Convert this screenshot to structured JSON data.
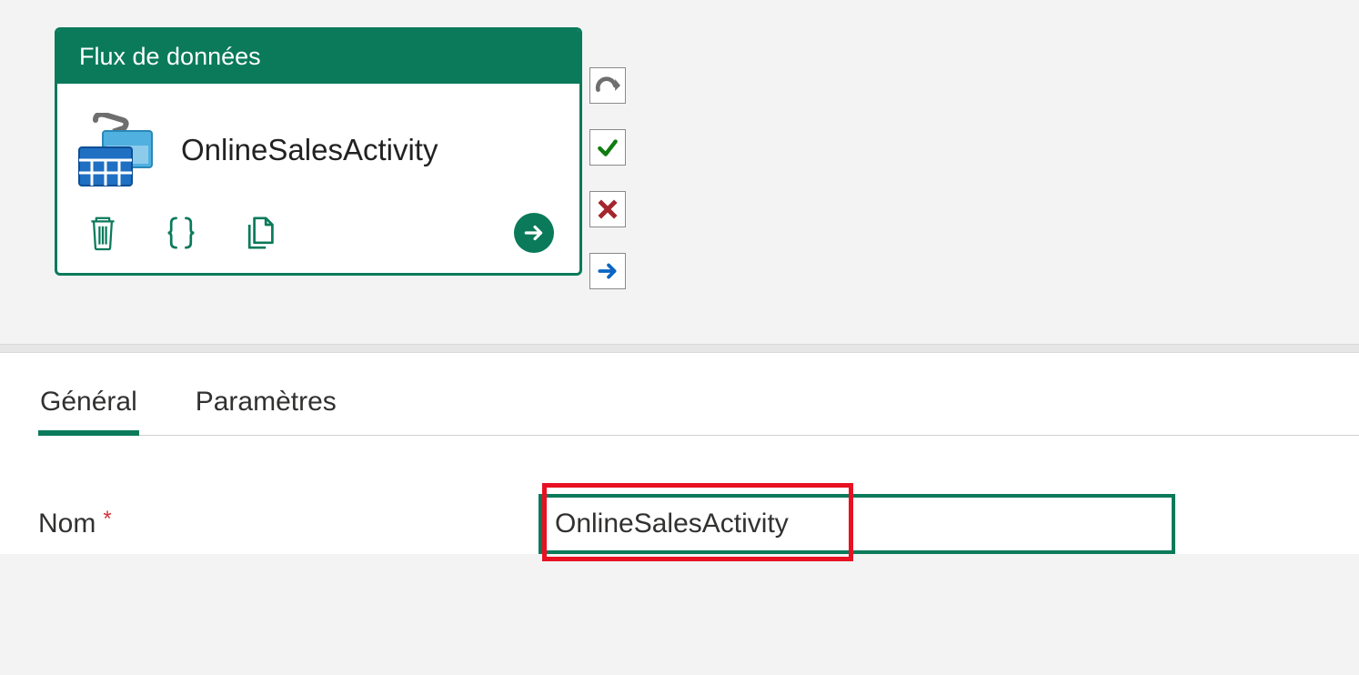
{
  "activity": {
    "header_title": "Flux de données",
    "name": "OnlineSalesActivity"
  },
  "connectors": {
    "loop": "loop-icon",
    "success": "check-icon",
    "failure": "x-icon",
    "completion": "arrow-icon"
  },
  "tabs": {
    "general": "Général",
    "settings": "Paramètres"
  },
  "form": {
    "name_label": "Nom",
    "required_mark": "*",
    "name_value": "OnlineSalesActivity"
  },
  "colors": {
    "primary": "#0a7a5a",
    "error": "#a4262c",
    "highlight": "#e81123"
  }
}
